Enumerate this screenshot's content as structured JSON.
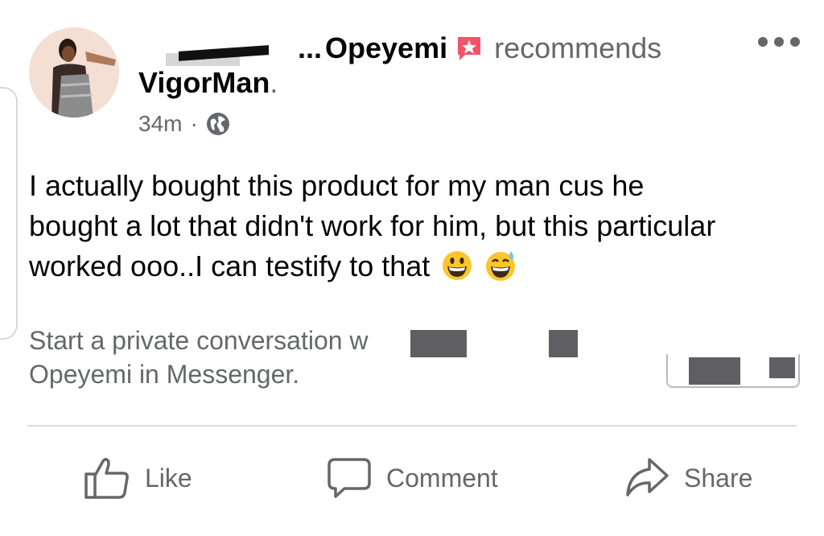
{
  "post": {
    "author_suffix": "Opeyemi",
    "author_prefix": "...",
    "action": "recommends",
    "page_name": "VigorMan",
    "page_name_dot": ".",
    "time": "34m",
    "separator": "·",
    "privacy_icon": "globe-icon",
    "more_icon": "more-options-icon",
    "text_lines": [
      "I actually bought this product for my man cus he",
      "bought a lot that didn't work for him, but this particular",
      "worked ooo..I can testify to that"
    ],
    "emojis": [
      "grinning-face-icon",
      "grinning-face-sweat-icon"
    ]
  },
  "private_conversation": {
    "line1": "Start a private conversation w",
    "line2": "Opeyemi in Messenger."
  },
  "actions": {
    "like_label": "Like",
    "comment_label": "Comment",
    "share_label": "Share"
  },
  "colors": {
    "text": "#050505",
    "secondary": "#65676b",
    "divider": "#d9dbdf",
    "badge": "#f35369",
    "redaction": "#5f5f63"
  }
}
